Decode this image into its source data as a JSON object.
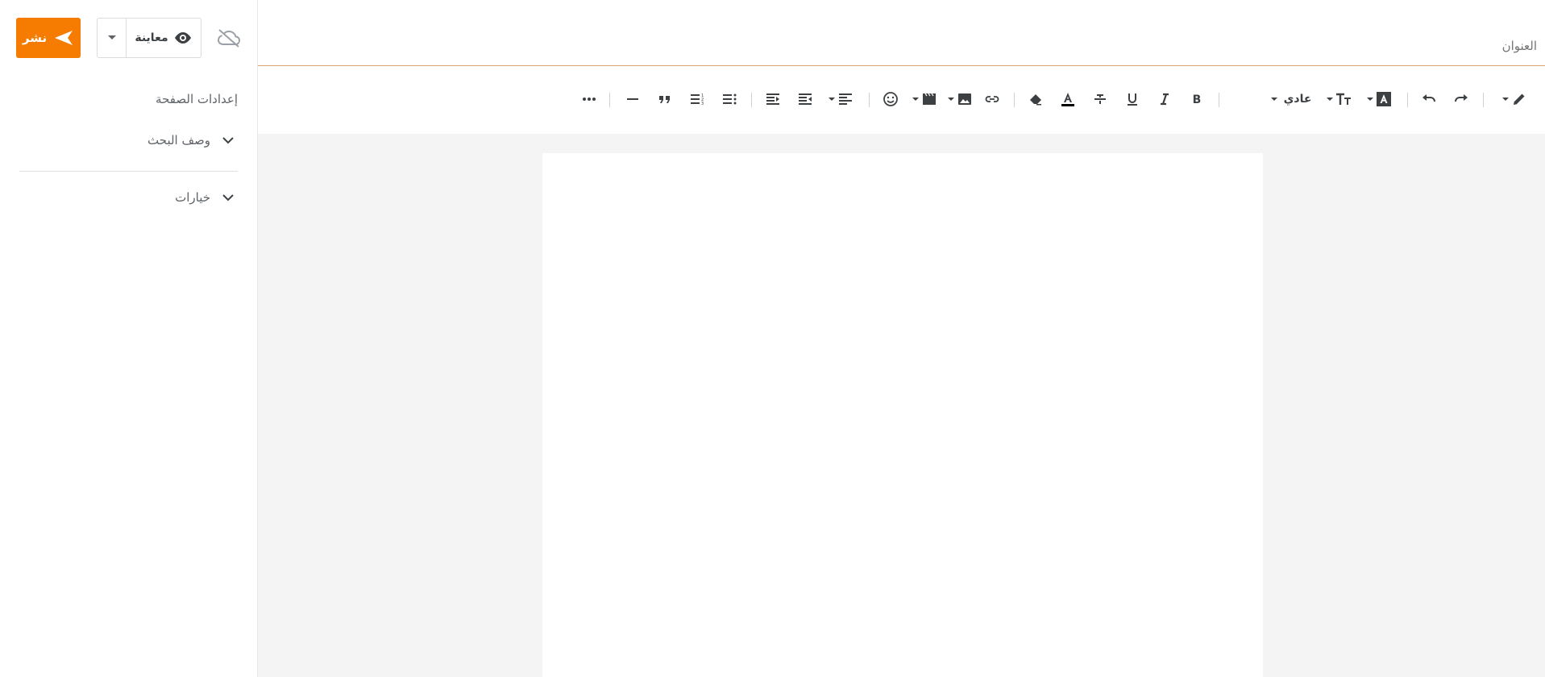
{
  "header": {
    "publish_label": "نشر",
    "preview_label": "معاينة",
    "title_placeholder": "العنوان"
  },
  "sidebar": {
    "section_title": "إعدادات الصفحة",
    "items": [
      {
        "label": "وصف البحث"
      },
      {
        "label": "خيارات"
      }
    ]
  },
  "toolbar": {
    "font_style_label": "عادي"
  },
  "colors": {
    "accent": "#f57c00",
    "title_underline": "#d8a878",
    "editor_background": "#f4f4f4"
  }
}
